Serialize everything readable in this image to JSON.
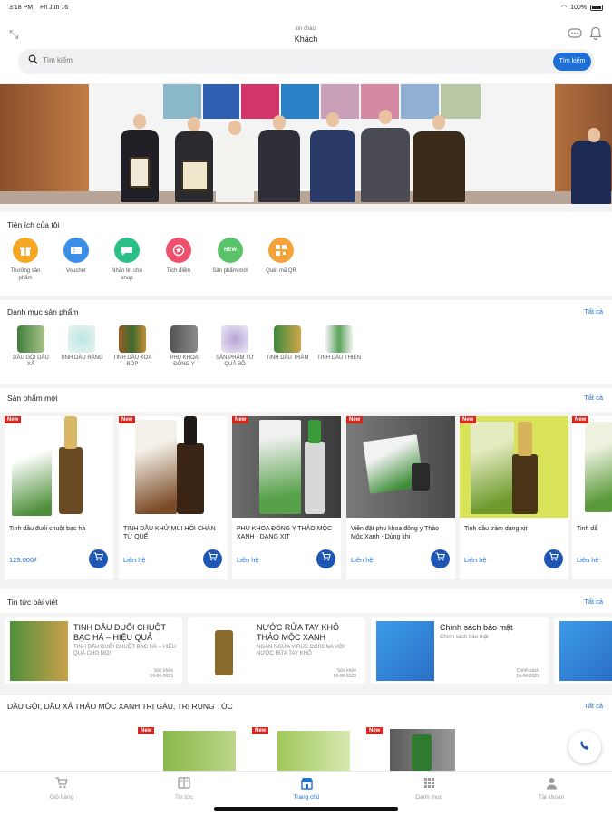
{
  "status_bar": {
    "time": "3:18 PM",
    "date": "Fri Jun 16",
    "battery": "100%"
  },
  "header": {
    "greeting": "xin chào!",
    "user_name": "Khách",
    "menu_icon": "expand-icon",
    "chat_icon": "chat-icon",
    "bell_icon": "bell-icon"
  },
  "search": {
    "placeholder": "Tìm kiếm",
    "button_label": "Tìm kiếm"
  },
  "utilities": {
    "title": "Tiện ích của tôi",
    "items": [
      {
        "label": "Thưởng sản phẩm",
        "icon": "gift-icon",
        "color": "#f5a623"
      },
      {
        "label": "Voucher",
        "icon": "voucher-icon",
        "color": "#3b8ee8"
      },
      {
        "label": "Nhắn tin cho shop",
        "icon": "message-icon",
        "color": "#2bbf86"
      },
      {
        "label": "Tích điểm",
        "icon": "points-icon",
        "color": "#f0506e"
      },
      {
        "label": "Sản phẩm mới",
        "icon": "new-icon",
        "color": "#5ac36a"
      },
      {
        "label": "Quét mã QR",
        "icon": "qr-icon",
        "color": "#f7a33b"
      }
    ]
  },
  "categories": {
    "title": "Danh mục sản phẩm",
    "see_all": "Tất cả",
    "items": [
      {
        "label": "Dầu gội dầu xả"
      },
      {
        "label": "Tinh dầu răng"
      },
      {
        "label": "Tinh dầu xoa bóp"
      },
      {
        "label": "Phụ khoa đông y"
      },
      {
        "label": "Sản phẩm từ quả bồ"
      },
      {
        "label": "Tinh dầu tràm"
      },
      {
        "label": "Tinh dầu thiên"
      }
    ]
  },
  "new_products": {
    "title": "Sản phẩm mới",
    "see_all": "Tất cả",
    "badge": "New",
    "items": [
      {
        "name": "Tinh dầu đuổi chuột bạc hà",
        "price": "125.000₫"
      },
      {
        "name": "TINH DẦU KHỬ MÙI HÔI CHÂN TỪ QUẾ",
        "price": "Liên hệ"
      },
      {
        "name": "PHỤ KHOA ĐÔNG Y THẢO MỘC XANH - DẠNG XỊT",
        "price": "Liên hệ"
      },
      {
        "name": "Viên đặt phụ khoa đông y Thảo Mộc Xanh - Dùng khi",
        "price": "Liên hệ"
      },
      {
        "name": "Tinh dầu tràm dạng xịt",
        "price": "Liên hệ"
      },
      {
        "name": "Tinh dầ",
        "price": "Liên hệ"
      }
    ]
  },
  "news": {
    "title": "Tin tức bài viết",
    "see_all": "Tất cả",
    "items": [
      {
        "title": "TINH DẦU ĐUỔI CHUỘT BẠC HÀ – HIỆU QUẢ",
        "summary": "TINH DẦU ĐUỔI CHUỘT BẠC HÀ – HIỆU QUẢ CHO MỌI",
        "meta": "Sức khỏe",
        "date": "16-06-2023"
      },
      {
        "title": "NƯỚC RỬA TAY KHÔ THẢO MỘC XANH",
        "summary": "NGĂN NGỪA VIRUS CORONA VỚI NƯỚC RỬA TAY KHÔ",
        "meta": "Sức khỏe",
        "date": "16-06-2023"
      },
      {
        "title": "Chính sách bảo mật",
        "summary": "Chính sách bảo mật",
        "meta": "Chính sách",
        "date": "16-06-2023"
      }
    ]
  },
  "shampoo_section": {
    "title": "DẦU GỘI, DẦU XẢ THẢO MỘC XANH TRỊ GÀU, TRỊ RỤNG TÓC",
    "see_all": "Tất cả",
    "badge": "New"
  },
  "tab_bar": {
    "items": [
      {
        "label": "Giỏ hàng",
        "icon": "cart-icon"
      },
      {
        "label": "Tin tức",
        "icon": "news-icon"
      },
      {
        "label": "Trang chủ",
        "icon": "home-icon"
      },
      {
        "label": "Danh mục",
        "icon": "grid-icon"
      },
      {
        "label": "Tài khoản",
        "icon": "user-icon"
      }
    ],
    "active_color": "#1e6fd6"
  }
}
